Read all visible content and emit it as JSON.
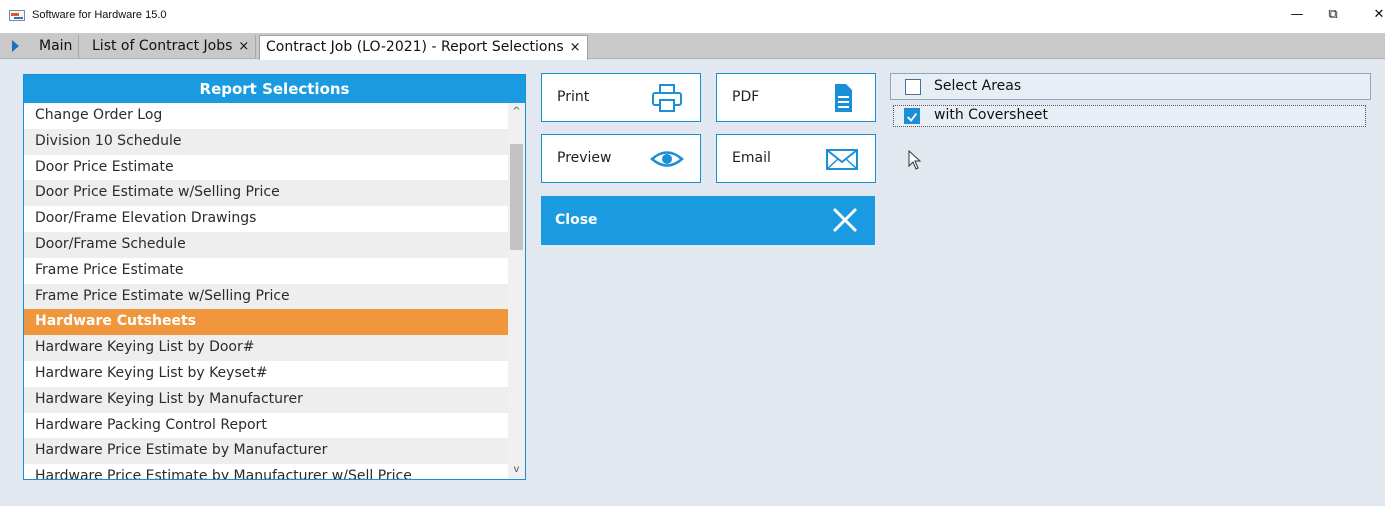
{
  "window": {
    "title": "Software for Hardware 15.0",
    "minimize_glyph": "—",
    "restore_glyph": "⧉",
    "close_glyph": "✕"
  },
  "tabs": [
    {
      "label": "Main",
      "closable": false
    },
    {
      "label": "List of Contract Jobs",
      "closable": true
    },
    {
      "label": "Contract Job (LO-2021) - Report Selections",
      "closable": true,
      "active": true
    }
  ],
  "tab_close_glyph": "×",
  "report_panel": {
    "header": "Report Selections",
    "items": [
      "Change Order Log",
      "Division 10 Schedule",
      "Door Price Estimate",
      "Door Price Estimate w/Selling Price",
      "Door/Frame Elevation Drawings",
      "Door/Frame Schedule",
      "Frame Price Estimate",
      "Frame Price Estimate w/Selling Price",
      "Hardware Cutsheets",
      "Hardware Keying List by Door#",
      "Hardware Keying List by Keyset#",
      "Hardware Keying List by Manufacturer",
      "Hardware Packing Control Report",
      "Hardware Price Estimate by Manufacturer",
      "Hardware Price Estimate by Manufacturer w/Sell Price"
    ],
    "selected_item": "Hardware Cutsheets",
    "scroll_up_glyph": "^",
    "scroll_down_glyph": "v"
  },
  "actions": {
    "print_label": "Print",
    "pdf_label": "PDF",
    "preview_label": "Preview",
    "email_label": "Email",
    "close_label": "Close",
    "print_icon": "printer-icon",
    "pdf_icon": "document-icon",
    "preview_icon": "eye-icon",
    "email_icon": "envelope-icon",
    "close_icon": "close-icon"
  },
  "options": {
    "select_areas": {
      "label": "Select Areas",
      "checked": false
    },
    "with_coversheet": {
      "label": "with Coversheet",
      "checked": true
    }
  },
  "colors": {
    "accent": "#1a9ae0",
    "selected_row": "#f0973e",
    "background": "#e1e8f0"
  }
}
